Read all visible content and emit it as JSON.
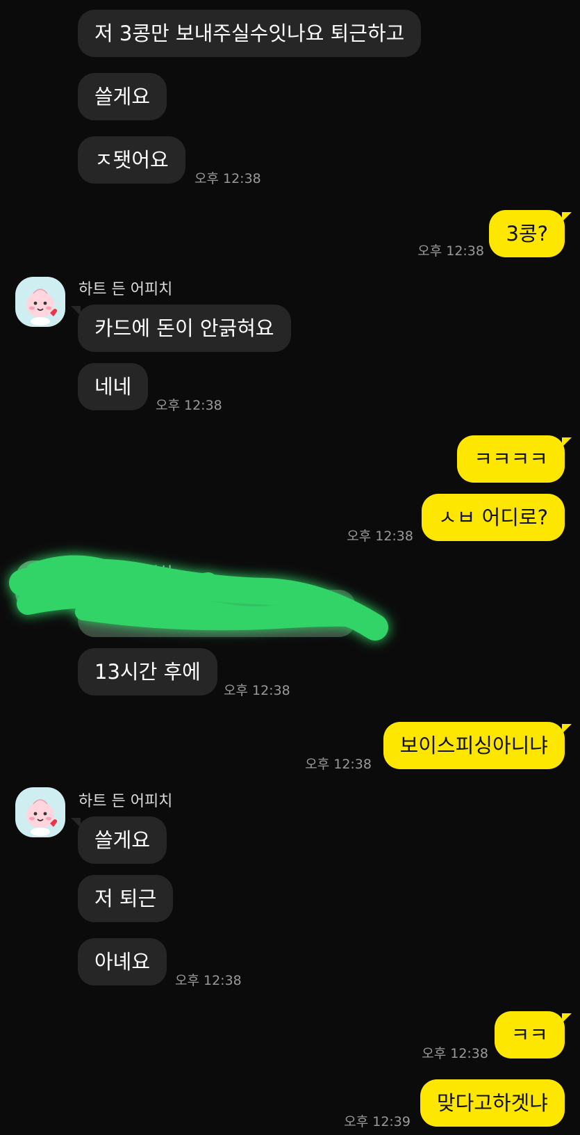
{
  "chat": {
    "sender_name": "하트 든 어피치",
    "messages": {
      "m1": "저 3콩만 보내주실수잇나요 퇴근하고",
      "m2": "쓸게요",
      "m3": "ㅈ됏어요",
      "m3_time": "오후 12:38",
      "m4": "3콩?",
      "m4_time": "오후 12:38",
      "m5": "카드에 돈이 안긁혀요",
      "m6": "네네",
      "m6_time": "오후 12:38",
      "m7": "ㅋㅋㅋㅋ",
      "m8": "ㅅㅂ 어디로?",
      "m8_time": "오후 12:38",
      "m10": "13시간 후에",
      "m10_time": "오후 12:38",
      "m11": "보이스피싱아니냐",
      "m11_time": "오후 12:38",
      "m12": "쓸게요",
      "m13": "저 퇴근",
      "m14": "아녜요",
      "m14_time": "오후 12:38",
      "m15": "ㅋㅋ",
      "m15_time": "오후 12:38",
      "m16": "맞다고하겟냐",
      "m16_time": "오후 12:39"
    }
  },
  "colors": {
    "background": "#0b0b0b",
    "incoming_bubble": "#262626",
    "outgoing_bubble": "#fde700",
    "timestamp": "#9a9a9a",
    "redaction_scribble": "#33d468"
  },
  "icons": {
    "avatar": "apeach-character-avatar"
  }
}
